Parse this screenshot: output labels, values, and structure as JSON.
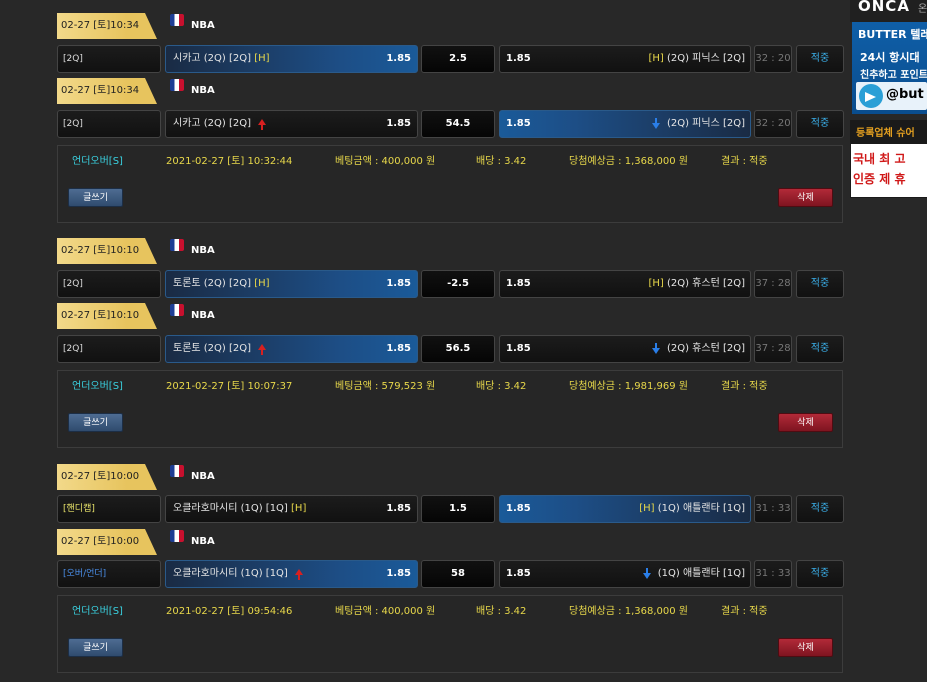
{
  "bets": [
    {
      "lines": [
        {
          "date": "02-27 [토]10:34",
          "league": "NBA",
          "type": "[2Q]",
          "home": {
            "name": "시카고 (2Q) [2Q]",
            "mark": "[H]",
            "odds": "1.85"
          },
          "mid": "2.5",
          "away": {
            "name": "(2Q) 피닉스 [2Q]",
            "mark": "[H]",
            "odds": "1.85"
          },
          "time": "32 : 20",
          "status": "적중"
        },
        {
          "date": "02-27 [토]10:34",
          "league": "NBA",
          "type": "[2Q]",
          "home": {
            "name": "시카고 (2Q) [2Q]",
            "odds": "1.85"
          },
          "mid": "54.5",
          "away": {
            "name": "(2Q) 피닉스 [2Q]",
            "odds": "1.85"
          },
          "time": "32 : 20",
          "status": "적중"
        }
      ],
      "summary": {
        "type": "언더오버[S]",
        "datetime": "2021-02-27 [토] 10:32:44",
        "amount": "베팅금액 : 400,000 원",
        "rate": "배당 : 3.42",
        "win": "당첨예상금 : 1,368,000 원",
        "result": "결과 : 적중",
        "write_label": "글쓰기",
        "delete_label": "삭제"
      }
    },
    {
      "lines": [
        {
          "date": "02-27 [토]10:10",
          "league": "NBA",
          "type": "[2Q]",
          "home": {
            "name": "토론토 (2Q) [2Q]",
            "mark": "[H]",
            "odds": "1.85"
          },
          "mid": "-2.5",
          "away": {
            "name": "(2Q) 휴스턴 [2Q]",
            "mark": "[H]",
            "odds": "1.85"
          },
          "time": "37 : 28",
          "status": "적중"
        },
        {
          "date": "02-27 [토]10:10",
          "league": "NBA",
          "type": "[2Q]",
          "home": {
            "name": "토론토 (2Q) [2Q]",
            "odds": "1.85"
          },
          "mid": "56.5",
          "away": {
            "name": "(2Q) 휴스턴 [2Q]",
            "odds": "1.85"
          },
          "time": "37 : 28",
          "status": "적중"
        }
      ],
      "summary": {
        "type": "언더오버[S]",
        "datetime": "2021-02-27 [토] 10:07:37",
        "amount": "베팅금액 : 579,523 원",
        "rate": "배당 : 3.42",
        "win": "당첨예상금 : 1,981,969 원",
        "result": "결과 : 적중",
        "write_label": "글쓰기",
        "delete_label": "삭제"
      }
    },
    {
      "lines": [
        {
          "date": "02-27 [토]10:00",
          "league": "NBA",
          "type": "[핸디캡]",
          "home": {
            "name": "오클라호마시티 (1Q) [1Q]",
            "mark": "[H]",
            "odds": "1.85"
          },
          "mid": "1.5",
          "away": {
            "name": "(1Q) 애틀랜타 [1Q]",
            "mark": "[H]",
            "odds": "1.85"
          },
          "time": "31 : 33",
          "status": "적중"
        },
        {
          "date": "02-27 [토]10:00",
          "league": "NBA",
          "type": "[오버/언더]",
          "home": {
            "name": "오클라호마시티 (1Q) [1Q]",
            "odds": "1.85"
          },
          "mid": "58",
          "away": {
            "name": "(1Q) 애틀랜타 [1Q]",
            "odds": "1.85"
          },
          "time": "31 : 33",
          "status": "적중"
        }
      ],
      "summary": {
        "type": "언더오버[S]",
        "datetime": "2021-02-27 [토] 09:54:46",
        "amount": "베팅금액 : 400,000 원",
        "rate": "배당 : 3.42",
        "win": "당첨예상금 : 1,368,000 원",
        "result": "결과 : 적중",
        "write_label": "글쓰기",
        "delete_label": "삭제"
      }
    }
  ],
  "sidebar": {
    "ad1": {
      "brand": "ONCA",
      "extra": "온"
    },
    "ad2": {
      "title": "BUTTER 텔레",
      "line1": "24시 항시대",
      "line2": "친추하고 포인트",
      "handle": "@but"
    },
    "ad3": {
      "title": "등록업체 슈어",
      "line1": "국내 최 고",
      "line2": "인증 제 휴"
    }
  },
  "colors": {
    "page_bg": "#282828",
    "date_gold": "#e7c45e",
    "selected_blue": "#1d4e86",
    "status_blue": "#3aaee8",
    "summary_yellow": "#e8d84a",
    "summary_cyan": "#3ad1e0",
    "delete_red": "#b22a38",
    "write_blue": "#4e6c92"
  }
}
